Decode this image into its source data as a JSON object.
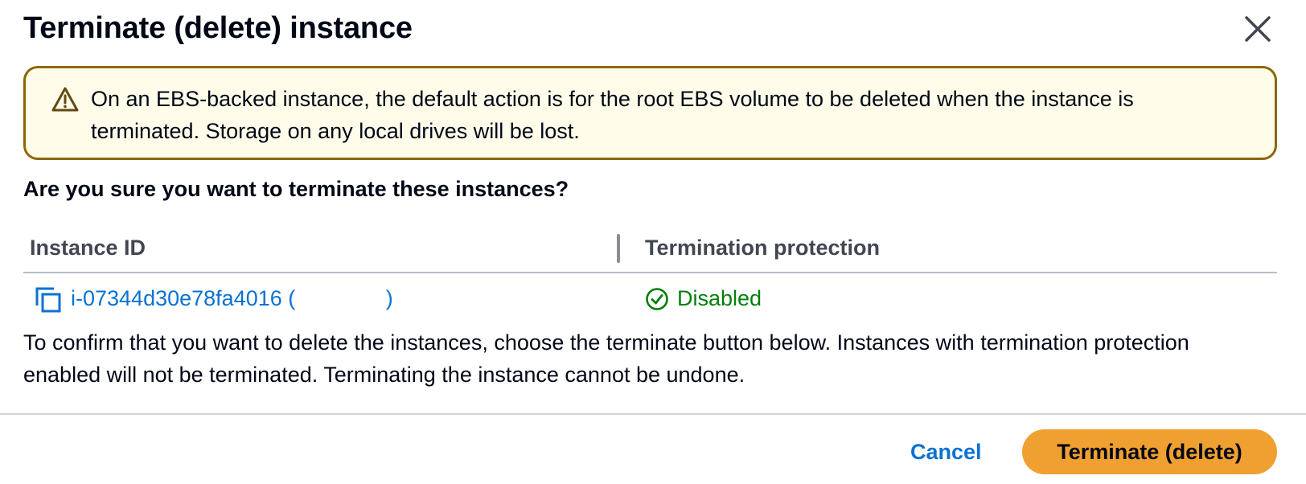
{
  "modal": {
    "title": "Terminate (delete) instance",
    "close_icon": "close-icon"
  },
  "alert": {
    "icon": "warning-icon",
    "text": "On an EBS-backed instance, the default action is for the root EBS volume to be deleted when the instance is terminated. Storage on any local drives will be lost.",
    "border_color": "#8d6605",
    "background_color": "#fffce9"
  },
  "question": "Are you sure you want to terminate these instances?",
  "table": {
    "columns": [
      "Instance ID",
      "Termination protection"
    ],
    "rows": [
      {
        "copy_icon": "copy-icon",
        "instance_id": "i-07344d30e78fa4016 (               )",
        "status_icon": "check-circle-icon",
        "termination_protection": "Disabled"
      }
    ]
  },
  "confirm_text": "To confirm that you want to delete the instances, choose the terminate button below. Instances with termination protection enabled will not be terminated. Terminating the instance cannot be undone.",
  "footer": {
    "cancel_label": "Cancel",
    "terminate_label": "Terminate (delete)"
  },
  "colors": {
    "link": "#0972d3",
    "success": "#037f0c",
    "primary_button": "#f0a030",
    "text": "#000716"
  }
}
